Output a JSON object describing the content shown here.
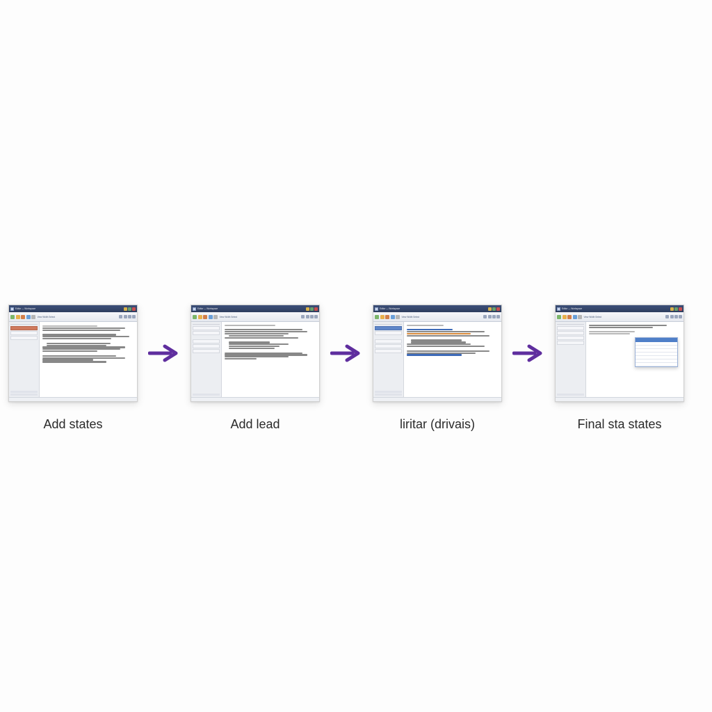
{
  "steps": [
    {
      "caption": "Add states"
    },
    {
      "caption": "Add lead"
    },
    {
      "caption": "liritar (drivais)"
    },
    {
      "caption": "Final sta states"
    }
  ],
  "thumb_common": {
    "toolbar_text": "View  Width  Select",
    "titlebar_text": "Editor — Workspace"
  },
  "colors": {
    "arrow": "#5f2e9e"
  }
}
